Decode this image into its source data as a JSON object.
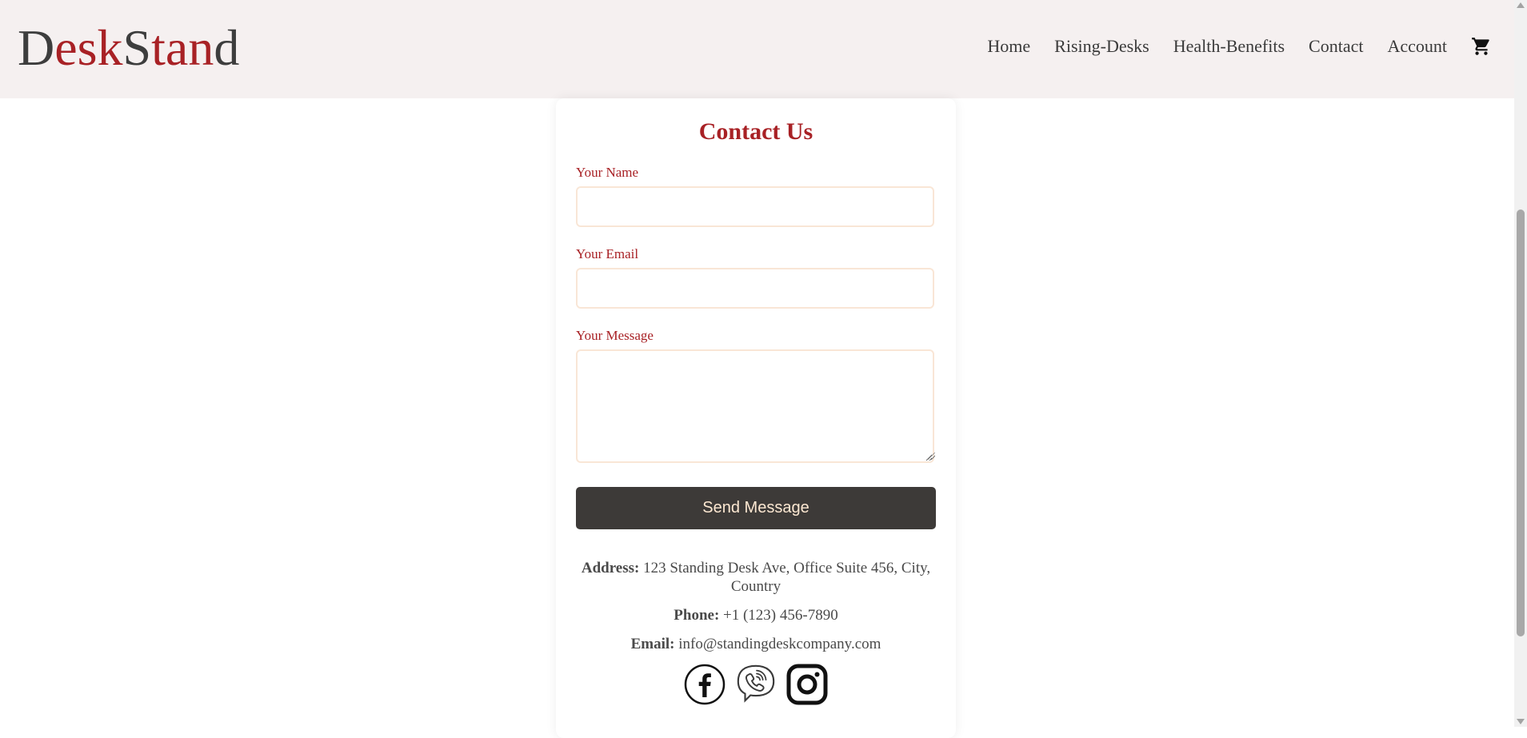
{
  "brand": {
    "logo_parts": [
      "D",
      "esk",
      "S",
      "t",
      "an",
      "d"
    ]
  },
  "nav": {
    "items": [
      {
        "label": "Home"
      },
      {
        "label": "Rising-Desks"
      },
      {
        "label": "Health-Benefits"
      },
      {
        "label": "Contact"
      },
      {
        "label": "Account"
      }
    ],
    "cart_icon": "shopping-cart-icon"
  },
  "contact": {
    "title": "Contact Us",
    "name_label": "Your Name",
    "name_value": "",
    "email_label": "Your Email",
    "email_value": "",
    "message_label": "Your Message",
    "message_value": "",
    "send_label": "Send Message",
    "address_label": "Address:",
    "address_value": "123 Standing Desk Ave, Office Suite 456, City, Country",
    "phone_label": "Phone:",
    "phone_value": "+1 (123) 456-7890",
    "email_info_label": "Email:",
    "email_info_value": "info@standingdeskcompany.com"
  },
  "socials": [
    "facebook-icon",
    "viber-icon",
    "instagram-icon"
  ],
  "colors": {
    "accent": "#a82125",
    "dark_text": "#3d3d3d",
    "nav_bg": "#f5f0f0",
    "button_bg": "#3d3a38",
    "button_text": "#fde8d2",
    "input_border": "#f9e6d6"
  }
}
